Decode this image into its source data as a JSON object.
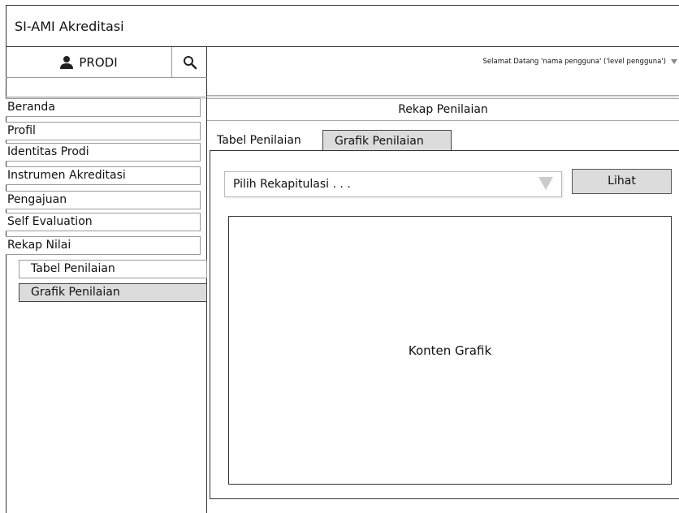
{
  "app": {
    "title": "SI-AMI Akreditasi"
  },
  "sidebar": {
    "user_label": "PRODI",
    "items": [
      {
        "label": "Beranda"
      },
      {
        "label": "Profil"
      },
      {
        "label": "Identitas Prodi"
      },
      {
        "label": "Instrumen Akreditasi"
      },
      {
        "label": "Pengajuan"
      },
      {
        "label": "Self Evaluation"
      },
      {
        "label": "Rekap Nilai"
      }
    ],
    "subitems": [
      {
        "label": "Tabel Penilaian",
        "active": false
      },
      {
        "label": "Grafik Penilaian",
        "active": true
      }
    ]
  },
  "header": {
    "welcome": "Selamat Datang 'nama pengguna' ('level pengguna')"
  },
  "main": {
    "title": "Rekap Penilaian",
    "tabs": [
      {
        "label": "Tabel Penilaian",
        "active": false
      },
      {
        "label": "Grafik Penilaian",
        "active": true
      }
    ],
    "select_value": "Pilih Rekapitulasi . . .",
    "button_label": "Lihat",
    "chart_placeholder": "Konten Grafik"
  },
  "icons": {
    "user": "user-icon",
    "search": "search-icon",
    "dropdown": "chevron-down-icon"
  },
  "colors": {
    "active_bg": "#dcdcdc",
    "border": "#333333"
  }
}
